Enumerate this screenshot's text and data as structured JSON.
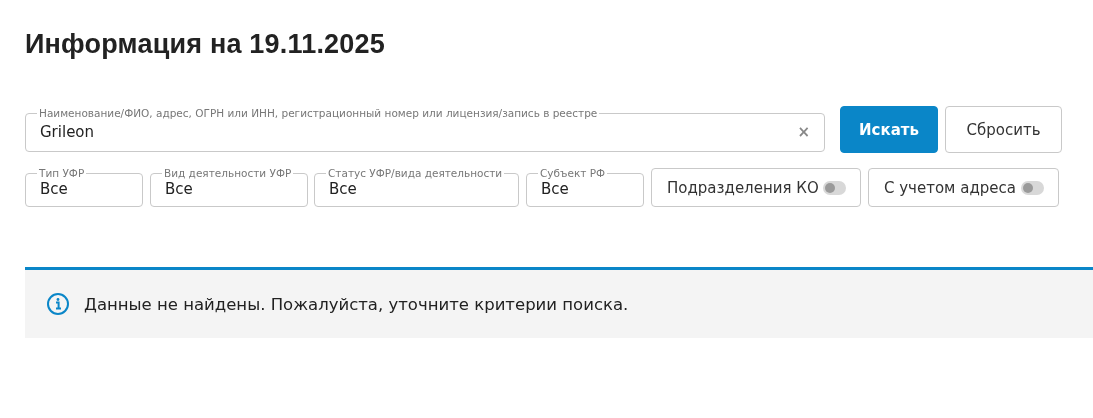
{
  "title": "Информация на 19.11.2025",
  "search": {
    "label": "Наименование/ФИО, адрес, ОГРН или ИНН, регистрационный номер или лицензия/запись в реестре",
    "value": "Grileon",
    "clear": "×"
  },
  "buttons": [
    {
      "label": "Искать",
      "kind": "primary"
    },
    {
      "label": "Сбросить",
      "kind": "secondary"
    }
  ],
  "filters": [
    {
      "kind": "select",
      "label": "Тип УФР",
      "value": "Все"
    },
    {
      "kind": "select",
      "label": "Вид деятельности УФР",
      "value": "Все"
    },
    {
      "kind": "select",
      "label": "Статус УФР/вида деятельности",
      "value": "Все"
    },
    {
      "kind": "select",
      "label": "Субъект РФ",
      "value": "Все"
    },
    {
      "kind": "toggle",
      "label": "Подразделения КО",
      "on": false
    },
    {
      "kind": "toggle",
      "label": "С учетом адреса",
      "on": false
    }
  ],
  "message": "Данные не найдены. Пожалуйста, уточните критерии поиска."
}
